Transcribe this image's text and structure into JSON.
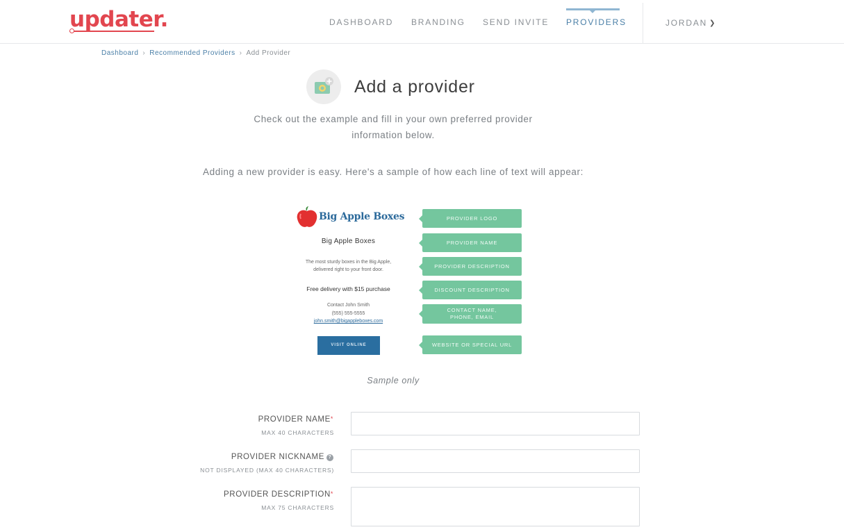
{
  "header": {
    "logo_text": "updater.",
    "nav": [
      {
        "label": "DASHBOARD"
      },
      {
        "label": "BRANDING"
      },
      {
        "label": "SEND INVITE"
      },
      {
        "label": "PROVIDERS",
        "active": true
      }
    ],
    "user_label": "JORDAN",
    "user_menu_icon": "chevron-down-icon"
  },
  "breadcrumb": {
    "items": [
      "Dashboard",
      "Recommended Providers",
      "Add Provider"
    ],
    "separator": "›"
  },
  "page": {
    "icon": "add-photo-icon",
    "title": "Add a provider",
    "intro": "Check out the example and fill in your own preferred provider information below.",
    "sample_lead": "Adding a new provider is easy. Here's a sample of how each line of text will appear:",
    "sample_note": "Sample only"
  },
  "sample": {
    "brand_name": "Big Apple Boxes",
    "brand_icon": "apple-icon",
    "provider_name": "Big Apple Boxes",
    "description_line1": "The most sturdy boxes in the Big Apple,",
    "description_line2": "delivered right to your front door.",
    "discount": "Free delivery with $15 purchase",
    "contact_name": "Contact John Smith",
    "contact_phone": "(555) 555-5555",
    "contact_email": "john.smith@bigappleboxes.com",
    "button_label": "VISIT ONLINE",
    "tags": [
      "PROVIDER LOGO",
      "PROVIDER NAME",
      "PROVIDER DESCRIPTION",
      "DISCOUNT DESCRIPTION",
      "CONTACT NAME,\nPHONE, EMAIL",
      "WEBSITE OR SPECIAL URL"
    ]
  },
  "form": {
    "fields": [
      {
        "label": "PROVIDER NAME",
        "required": "*",
        "hint": "MAX 40 CHARACTERS",
        "value": ""
      },
      {
        "label": "PROVIDER NICKNAME",
        "help_icon": "question-icon",
        "hint": "NOT DISPLAYED (MAX 40 CHARACTERS)",
        "value": ""
      },
      {
        "label": "PROVIDER DESCRIPTION",
        "required": "*",
        "hint": "MAX 75 CHARACTERS",
        "value": ""
      }
    ]
  },
  "colors": {
    "brand": "#e2464f",
    "nav_active": "#4a7fa7",
    "tag_green": "#74c69e",
    "sample_button": "#2a6ea0"
  }
}
